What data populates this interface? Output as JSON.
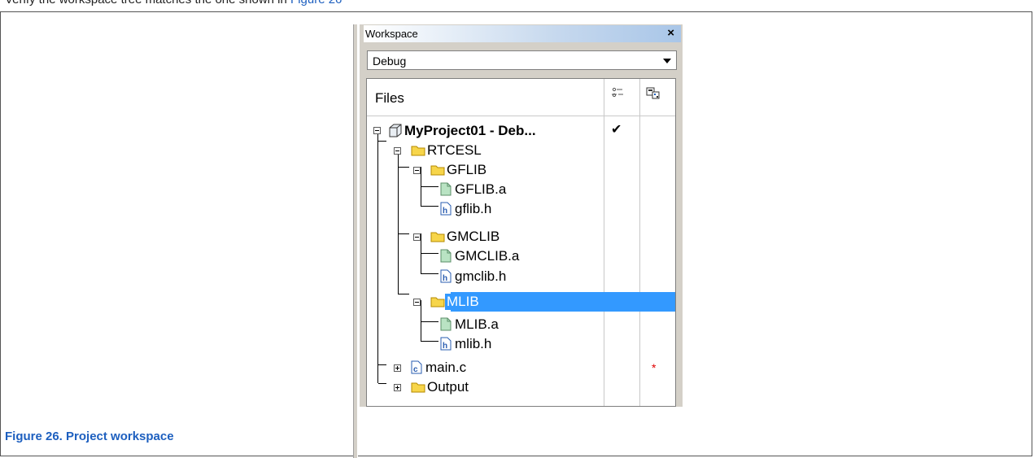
{
  "page": {
    "top_text": "Verify the workspace tree matches the one shown in ",
    "top_link": "Figure 26"
  },
  "workspace": {
    "title": "Workspace",
    "close_label": "×",
    "configuration": "Debug",
    "files_header": "Files",
    "header_icons": [
      "options-icon",
      "make-status-icon"
    ]
  },
  "tree": {
    "project": {
      "label": "MyProject01 - Deb...",
      "checked": "✔"
    },
    "items": [
      {
        "label": "RTCESL",
        "type": "folder"
      },
      {
        "label": "GFLIB",
        "type": "folder"
      },
      {
        "label": "GFLIB.a",
        "type": "library-file"
      },
      {
        "label": "gflib.h",
        "type": "header-file"
      },
      {
        "label": "GMCLIB",
        "type": "folder"
      },
      {
        "label": "GMCLIB.a",
        "type": "library-file"
      },
      {
        "label": "gmclib.h",
        "type": "header-file"
      },
      {
        "label": "MLIB",
        "type": "folder",
        "selected": true
      },
      {
        "label": "MLIB.a",
        "type": "library-file"
      },
      {
        "label": "mlib.h",
        "type": "header-file"
      },
      {
        "label": "main.c",
        "type": "c-file",
        "modified": "*"
      },
      {
        "label": "Output",
        "type": "folder"
      }
    ]
  },
  "caption": "Figure 26. Project workspace",
  "colors": {
    "selection": "#3399ff",
    "folder": "#f7d54a",
    "library_file": "#b9e3c3",
    "caption": "#1d5fbf"
  }
}
